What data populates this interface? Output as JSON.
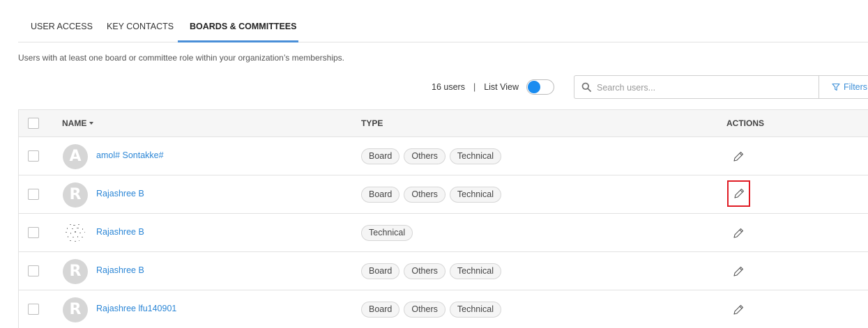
{
  "tabs": [
    {
      "label": "USER ACCESS",
      "active": false
    },
    {
      "label": "KEY CONTACTS",
      "active": false
    },
    {
      "label": "BOARDS & COMMITTEES",
      "active": true
    }
  ],
  "description": "Users with at least one board or committee role within your organization’s memberships.",
  "toolbar": {
    "count": "16 users",
    "separator": "|",
    "list_view_label": "List View",
    "search_placeholder": "Search users...",
    "filters_label": "Filters"
  },
  "table": {
    "headers": {
      "name": "NAME",
      "type": "TYPE",
      "actions": "ACTIONS"
    },
    "rows": [
      {
        "avatar": "A",
        "name": "amol# Sontakke#",
        "types": [
          "Board",
          "Others",
          "Technical"
        ]
      },
      {
        "avatar": "R",
        "name": "Rajashree B",
        "types": [
          "Board",
          "Others",
          "Technical"
        ]
      },
      {
        "avatar": "",
        "name": "Rajashree B",
        "types": [
          "Technical"
        ]
      },
      {
        "avatar": "R",
        "name": "Rajashree B",
        "types": [
          "Board",
          "Others",
          "Technical"
        ]
      },
      {
        "avatar": "R",
        "name": "Rajashree lfu140901",
        "types": [
          "Board",
          "Others",
          "Technical"
        ]
      }
    ]
  },
  "colors": {
    "accent": "#2b86d6",
    "toggle_knob": "#1a8cf0",
    "highlight": "#e01b24",
    "tab_underline": "#4a8fd8"
  },
  "icons": {
    "search": "search-icon",
    "filter": "filter-icon",
    "edit": "pencil-icon",
    "sort": "caret-down-icon"
  }
}
